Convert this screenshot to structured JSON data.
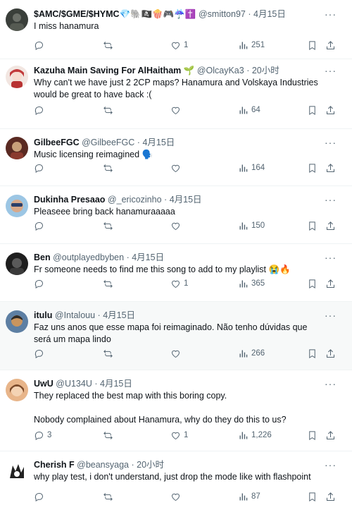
{
  "tweets": [
    {
      "name": "$AMC/$GME/$HYMC💎🐘🏴‍☠️🍿🎮☔✝️",
      "handle": "@smitton97",
      "time": "4月15日",
      "text": "I miss hanamura",
      "replies": "",
      "reposts": "",
      "likes": "1",
      "views": "251",
      "avatar_color": "#3a3f3a"
    },
    {
      "name": "Kazuha Main Saving For AlHaitham 🌱",
      "handle": "@OlcayKa3",
      "time": "20小时",
      "text": "Why can't we have just 2 2CP maps? Hanamura and Volskaya Industries would be great to have back :(",
      "replies": "",
      "reposts": "",
      "likes": "",
      "views": "64",
      "avatar_color": "#e9d6cf"
    },
    {
      "name": "GilbeeFGC",
      "handle": "@GilbeeFGC",
      "time": "4月15日",
      "text": "Music licensing reimagined 🗣️",
      "replies": "",
      "reposts": "",
      "likes": "",
      "views": "164",
      "avatar_color": "#8a3a2e"
    },
    {
      "name": "Dukinha Presaao",
      "handle": "@_ericozinho",
      "time": "4月15日",
      "text": "Pleaseee bring back hanamuraaaaa",
      "replies": "",
      "reposts": "",
      "likes": "",
      "views": "150",
      "avatar_color": "#7fb2d8"
    },
    {
      "name": "Ben",
      "handle": "@outplayedbyben",
      "time": "4月15日",
      "text": "Fr someone needs to find me this song to add to my playlist 😭🔥",
      "replies": "",
      "reposts": "",
      "likes": "1",
      "views": "365",
      "avatar_color": "#2b2b2b"
    },
    {
      "name": "itulu",
      "handle": "@Intalouu",
      "time": "4月15日",
      "text": "Faz uns anos que esse mapa foi reimaginado. Não tenho dúvidas que será um mapa lindo",
      "replies": "",
      "reposts": "",
      "likes": "",
      "views": "266",
      "avatar_color": "#4a6a8c"
    },
    {
      "name": "UwU",
      "handle": "@U134U",
      "time": "4月15日",
      "text": "They replaced the best map with this boring copy.\n\nNobody complained about Hanamura, why do they do this to us?",
      "replies": "3",
      "reposts": "",
      "likes": "1",
      "views": "1,226",
      "avatar_color": "#c98a5a"
    },
    {
      "name": "Cherish F",
      "handle": "@beansyaga",
      "time": "20小时",
      "text": "why play test, i don't understand, just drop the mode like with flashpoint",
      "replies": "",
      "reposts": "",
      "likes": "",
      "views": "87",
      "avatar_color": "#ffffff"
    }
  ],
  "labels": {
    "separator": "·",
    "more": "···"
  }
}
